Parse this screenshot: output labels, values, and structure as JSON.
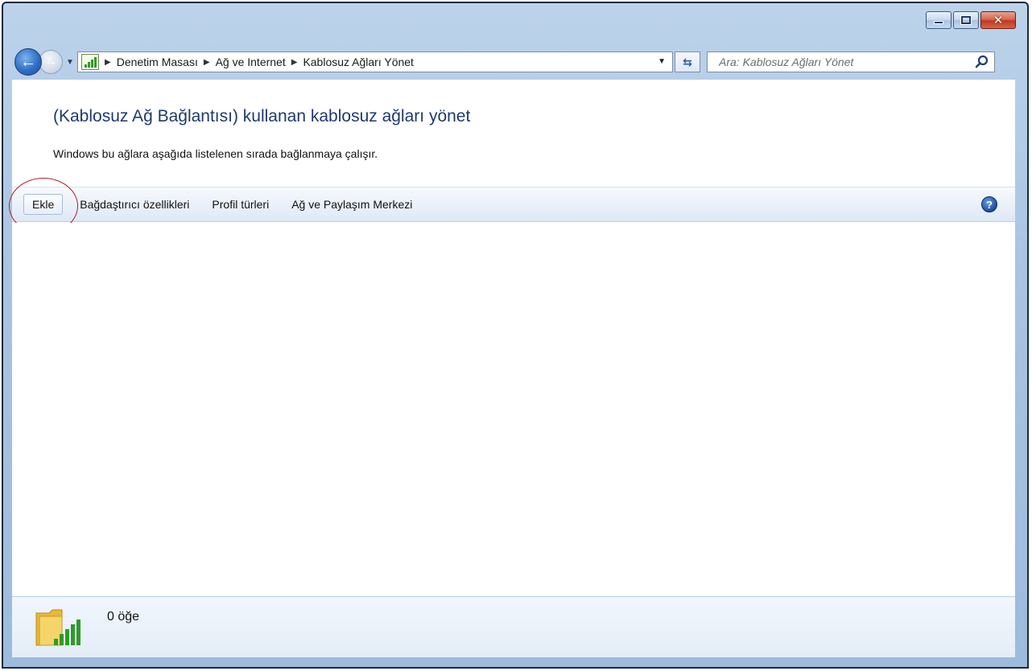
{
  "window": {
    "caption_buttons": [
      "minimize",
      "maximize",
      "close"
    ]
  },
  "nav": {
    "breadcrumbs": [
      "Denetim Masası",
      "Ağ ve Internet",
      "Kablosuz Ağları Yönet"
    ],
    "search_placeholder": "Ara: Kablosuz Ağları Yönet",
    "icons": [
      "back-arrow-icon",
      "forward-arrow-icon",
      "network-signal-icon",
      "refresh-icon",
      "search-icon"
    ]
  },
  "header": {
    "title": "(Kablosuz Ağ Bağlantısı) kullanan kablosuz ağları yönet",
    "subtitle": "Windows bu ağlara aşağıda listelenen sırada bağlanmaya çalışır."
  },
  "toolbar": {
    "items": [
      "Ekle",
      "Bağdaştırıcı özellikleri",
      "Profil türleri",
      "Ağ ve Paylaşım Merkezi"
    ],
    "help_label": "?"
  },
  "details": {
    "item_count": "0 öğe"
  },
  "colors": {
    "title_text": "#1e3a6f",
    "highlight_ring": "#b0202a",
    "close_button": "#c2391c"
  }
}
